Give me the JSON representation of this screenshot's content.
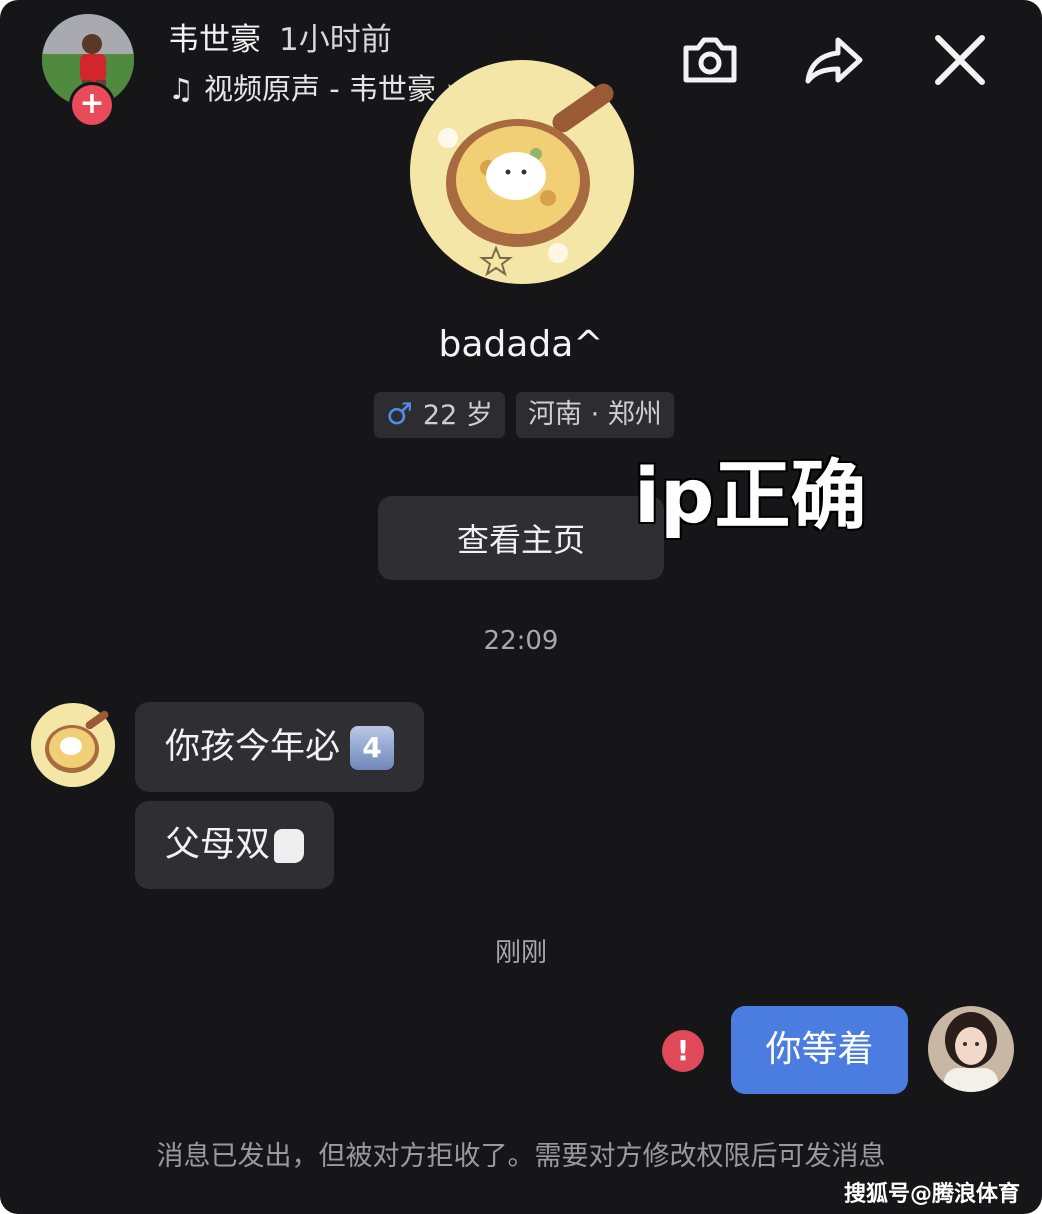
{
  "header": {
    "author_name": "韦世豪",
    "post_time": "1小时前",
    "music_icon": "music-note-icon",
    "music_text": "视频原声 - 韦世豪",
    "follow_symbol": "+"
  },
  "profile": {
    "name": "badada^",
    "gender_symbol": "♂",
    "age": "22 岁",
    "location": "河南 · 郑州",
    "view_home_label": "查看主页"
  },
  "overlay_caption": "ip正确",
  "chat": {
    "timestamp_1": "22:09",
    "received": [
      {
        "text": "你孩今年必",
        "emoji": "4"
      },
      {
        "text": "父母双"
      }
    ],
    "timestamp_2": "刚刚",
    "sent": {
      "text": "你等着",
      "status_symbol": "!"
    },
    "notice": "消息已发出，但被对方拒收了。需要对方修改权限后可发消息"
  },
  "watermark": "搜狐号@腾浪体育",
  "colors": {
    "background": "#161618",
    "bubble_received": "#2f2f33",
    "bubble_sent": "#4b7de0",
    "error_red": "#e04a58",
    "follow_red": "#e84b5a"
  }
}
